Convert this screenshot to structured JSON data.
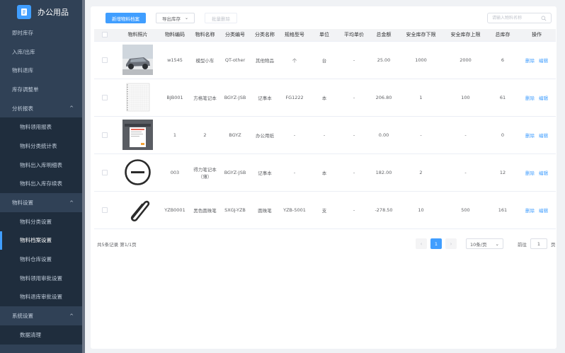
{
  "brand": {
    "title": "办公用品"
  },
  "sidebar": {
    "items": [
      {
        "label": "即时库存",
        "type": "top"
      },
      {
        "label": "入库/出库",
        "type": "top"
      },
      {
        "label": "物料退库",
        "type": "top"
      },
      {
        "label": "库存调整单",
        "type": "top"
      },
      {
        "label": "分析报表",
        "type": "group",
        "arrow": "^"
      },
      {
        "label": "物料领用报表",
        "type": "sub"
      },
      {
        "label": "物料分类统计表",
        "type": "sub"
      },
      {
        "label": "物料出入库明细表",
        "type": "sub"
      },
      {
        "label": "物料出入库存续表",
        "type": "sub"
      },
      {
        "label": "物料设置",
        "type": "group",
        "arrow": "^"
      },
      {
        "label": "物料分类设置",
        "type": "sub"
      },
      {
        "label": "物料档案设置",
        "type": "sub",
        "active": true
      },
      {
        "label": "物料仓库设置",
        "type": "sub"
      },
      {
        "label": "物料领用审批设置",
        "type": "sub"
      },
      {
        "label": "物料退库审批设置",
        "type": "sub"
      },
      {
        "label": "系统设置",
        "type": "group",
        "arrow": "^"
      },
      {
        "label": "数据清理",
        "type": "sub"
      }
    ]
  },
  "toolbar": {
    "add_label": "新增物料档案",
    "export_label": "导出库存",
    "export_chevron": "⌄",
    "batch_delete_label": "批量删除"
  },
  "search": {
    "placeholder": "请输入物料名称"
  },
  "table": {
    "columns": [
      "",
      "物料照片",
      "物料编码",
      "物料名称",
      "分类编号",
      "分类名称",
      "规格型号",
      "单位",
      "平均单价",
      "总金额",
      "安全库存下限",
      "安全库存上限",
      "总库存",
      "操作"
    ],
    "rows": [
      {
        "thumb": "car",
        "code": "w1545",
        "name": "模型小车",
        "cat_code": "QT-other",
        "cat_name": "其他物品",
        "spec": "个",
        "unit": "台",
        "avg_price": "-",
        "total": "25.00",
        "min": "1000",
        "max": "2000",
        "stock": "6"
      },
      {
        "thumb": "notebook",
        "code": "BJB001",
        "name": "方格笔记本",
        "cat_code": "BGYZ-JSB",
        "cat_name": "记事本",
        "spec": "FG1222",
        "unit": "本",
        "avg_price": "-",
        "total": "206.80",
        "min": "1",
        "max": "100",
        "stock": "61"
      },
      {
        "thumb": "screenshot",
        "code": "1",
        "name": "2",
        "cat_code": "BGYZ",
        "cat_name": "办公用纸",
        "spec": "-",
        "unit": "-",
        "avg_price": "-",
        "total": "0.00",
        "min": "-",
        "max": "-",
        "stock": "0"
      },
      {
        "thumb": "minus",
        "code": "003",
        "name": "得力笔记本（薄）",
        "cat_code": "BGYZ-JSB",
        "cat_name": "记事本",
        "spec": "-",
        "unit": "本",
        "avg_price": "-",
        "total": "182.00",
        "min": "2",
        "max": "-",
        "stock": "12"
      },
      {
        "thumb": "paperclip",
        "code": "YZB0001",
        "name": "黑色圆珠笔",
        "cat_code": "SXGJ-YZB",
        "cat_name": "圆珠笔",
        "spec": "YZB-5001",
        "unit": "支",
        "avg_price": "-",
        "total": "-278.50",
        "min": "10",
        "max": "500",
        "stock": "161"
      }
    ],
    "ops": {
      "delete": "删除",
      "edit": "编辑"
    }
  },
  "footer": {
    "summary": "共5条记录  第1/1页",
    "prev": "‹",
    "current_page": "1",
    "next": "›",
    "page_size": "10条/页",
    "page_size_chevron": "⌄",
    "goto_label": "前往",
    "goto_value": "1",
    "goto_suffix": "页"
  },
  "colors": {
    "primary": "#409eff",
    "sidebar": "#304156",
    "sidebar_sub": "#1f2d3d"
  }
}
